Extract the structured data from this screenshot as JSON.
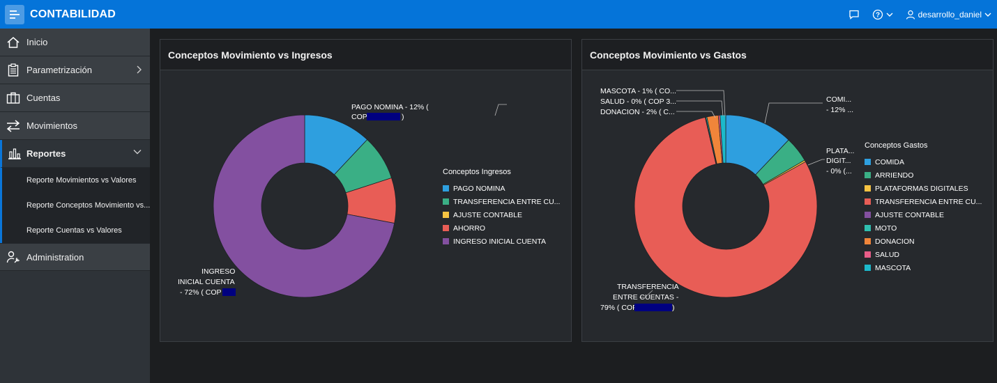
{
  "header": {
    "app_title": "CONTABILIDAD",
    "user_name": "desarrollo_daniel",
    "icons": [
      "menu-icon",
      "chat-icon",
      "help-icon",
      "user-icon"
    ]
  },
  "sidebar": {
    "items": [
      {
        "label": "Inicio",
        "icon": "home-icon"
      },
      {
        "label": "Parametrización",
        "icon": "clipboard-icon"
      },
      {
        "label": "Cuentas",
        "icon": "briefcase-icon"
      },
      {
        "label": "Movimientos",
        "icon": "arrows-icon"
      },
      {
        "label": "Reportes",
        "icon": "bar-chart-icon"
      },
      {
        "label": "Administration",
        "icon": "wrench-user-icon"
      }
    ],
    "subitems": [
      {
        "label": "Reporte Movimientos vs Valores"
      },
      {
        "label": "Reporte Conceptos Movimiento vs..."
      },
      {
        "label": "Reporte Cuentas vs Valores"
      }
    ]
  },
  "colors": {
    "header_bg": "#0574d9",
    "blue": "#2e9fdf",
    "green": "#3aaf85",
    "yellow": "#f6c342",
    "red": "#e85d56",
    "purple": "#8350a0",
    "teal": "#2fbfb0",
    "orange": "#f0853a",
    "pink": "#e85d88",
    "cyan": "#1cb9cb",
    "redaction": "#000080"
  },
  "panels": {
    "ingresos": {
      "title": "Conceptos Movimiento vs Ingresos",
      "legend_title": "Conceptos Ingresos",
      "callouts": {
        "pago_line1": "PAGO NOMINA - 12% (",
        "pago_line2_a": "COP",
        "pago_line2_b": ")",
        "ingreso_line1": "INGRESO",
        "ingreso_line2": "INICIAL CUENTA",
        "ingreso_line3": "- 72% ( COP"
      }
    },
    "gastos": {
      "title": "Conceptos Movimiento vs Gastos",
      "legend_title": "Conceptos Gastos",
      "callouts": {
        "mascota": "MASCOTA - 1% ( CO...",
        "salud": "SALUD - 0% ( COP 3...",
        "donacion": "DONACION - 2% ( C...",
        "comida_1": "COMI...",
        "comida_2": "- 12% ...",
        "plat_1": "PLATA...",
        "plat_2": "DIGIT...",
        "plat_3": "- 0% (...",
        "transf_1": "TRANSFERENCIA",
        "transf_2": "ENTRE CUENTAS -",
        "transf_3": "79% ( COP",
        "transf_close": ")"
      }
    }
  },
  "chart_data": [
    {
      "type": "pie",
      "title": "Conceptos Movimiento vs Ingresos",
      "legend_title": "Conceptos Ingresos",
      "legend_placement": "right",
      "categories": [
        "PAGO NOMINA",
        "TRANSFERENCIA ENTRE CU...",
        "AJUSTE CONTABLE",
        "AHORRO",
        "INGRESO INICIAL CUENTA"
      ],
      "legend_labels": [
        "PAGO NOMINA",
        "TRANSFERENCIA ENTRE CU...",
        "AJUSTE CONTABLE",
        "AHORRO",
        "INGRESO INICIAL CUENTA"
      ],
      "values": [
        12,
        8,
        0,
        8,
        72
      ],
      "colors": [
        "#2e9fdf",
        "#3aaf85",
        "#f6c342",
        "#e85d56",
        "#8350a0"
      ]
    },
    {
      "type": "pie",
      "title": "Conceptos Movimiento vs Gastos",
      "legend_title": "Conceptos Gastos",
      "legend_placement": "right",
      "categories": [
        "COMIDA",
        "ARRIENDO",
        "PLATAFORMAS DIGITALES",
        "TRANSFERENCIA ENTRE CU...",
        "AJUSTE CONTABLE",
        "MOTO",
        "DONACION",
        "SALUD",
        "MASCOTA"
      ],
      "legend_labels": [
        "COMIDA",
        "ARRIENDO",
        "PLATAFORMAS DIGITALES",
        "TRANSFERENCIA ENTRE CU...",
        "AJUSTE CONTABLE",
        "MOTO",
        "DONACION",
        "SALUD",
        "MASCOTA"
      ],
      "values": [
        12,
        4.5,
        0.3,
        79,
        0.1,
        0.2,
        2,
        0.3,
        1
      ],
      "colors": [
        "#2e9fdf",
        "#3aaf85",
        "#f6c342",
        "#e85d56",
        "#8350a0",
        "#2fbfb0",
        "#f0853a",
        "#e85d88",
        "#1cb9cb"
      ]
    }
  ]
}
